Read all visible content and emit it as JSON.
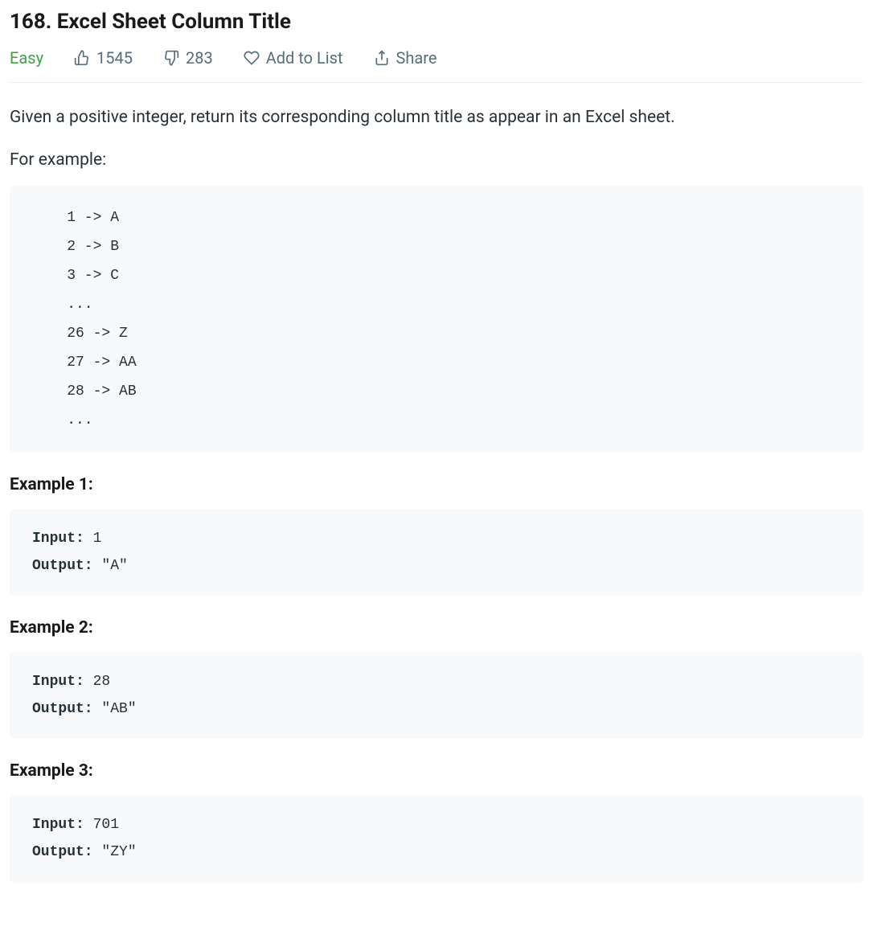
{
  "title": "168. Excel Sheet Column Title",
  "difficulty": "Easy",
  "likes": "1545",
  "dislikes": "283",
  "add_to_list": "Add to List",
  "share": "Share",
  "description": "Given a positive integer, return its corresponding column title as appear in an Excel sheet.",
  "for_example": "For example:",
  "mapping_block": "    1 -> A\n    2 -> B\n    3 -> C\n    ...\n    26 -> Z\n    27 -> AA\n    28 -> AB \n    ...",
  "examples": [
    {
      "heading": "Example 1:",
      "input_label": "Input:",
      "input_value": " 1",
      "output_label": "Output:",
      "output_value": " \"A\""
    },
    {
      "heading": "Example 2:",
      "input_label": "Input:",
      "input_value": " 28",
      "output_label": "Output:",
      "output_value": " \"AB\""
    },
    {
      "heading": "Example 3:",
      "input_label": "Input:",
      "input_value": " 701",
      "output_label": "Output:",
      "output_value": " \"ZY\""
    }
  ]
}
